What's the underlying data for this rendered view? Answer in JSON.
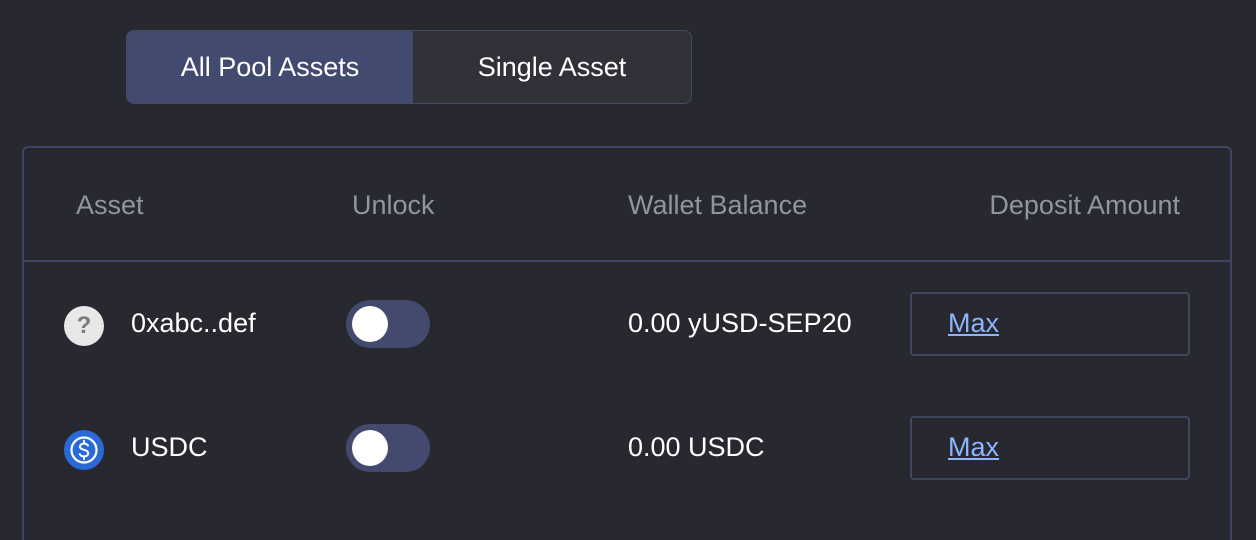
{
  "tabs": [
    {
      "label": "All Pool Assets",
      "active": true
    },
    {
      "label": "Single Asset",
      "active": false
    }
  ],
  "table": {
    "headers": {
      "asset": "Asset",
      "unlock": "Unlock",
      "wallet_balance": "Wallet Balance",
      "deposit_amount": "Deposit Amount"
    },
    "rows": [
      {
        "asset": "0xabc..def",
        "icon": "unknown-token-icon",
        "icon_glyph": "?",
        "unlocked": false,
        "balance": "0.00 yUSD-SEP20",
        "max_label": "Max"
      },
      {
        "asset": "USDC",
        "icon": "usdc-icon",
        "unlocked": false,
        "balance": "0.00 USDC",
        "max_label": "Max"
      }
    ]
  },
  "colors": {
    "background": "#282830",
    "accent": "#434a70",
    "link": "#8cb4ff",
    "usdc_blue": "#2a6ad6"
  }
}
